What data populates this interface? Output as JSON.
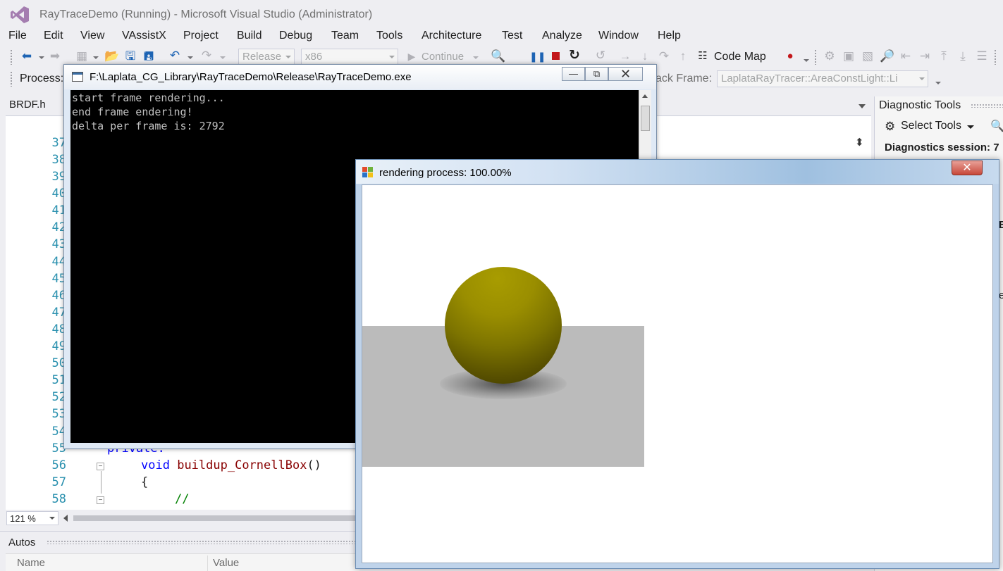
{
  "window": {
    "title": "RayTraceDemo (Running) - Microsoft Visual Studio (Administrator)"
  },
  "menu": [
    "File",
    "Edit",
    "View",
    "VAssistX",
    "Project",
    "Build",
    "Debug",
    "Team",
    "Tools",
    "Architecture",
    "Test",
    "Analyze",
    "Window",
    "Help"
  ],
  "toolbar": {
    "configuration": "Release",
    "platform": "x86",
    "continue_label": "Continue",
    "code_map_label": "Code Map",
    "process_label": "Process:",
    "stack_frame_label": "ack Frame:",
    "stack_frame_value": "LaplataRayTracer::AreaConstLight::Li"
  },
  "editor": {
    "tab_label": "BRDF.h",
    "line_numbers": [
      "37",
      "38",
      "39",
      "40",
      "41",
      "42",
      "43",
      "44",
      "45",
      "46",
      "47",
      "48",
      "49",
      "50",
      "51",
      "52",
      "53",
      "54",
      "55",
      "56",
      "57",
      "58"
    ],
    "code": {
      "line55": "private:",
      "line56_kw": "void",
      "line56_fn": "buildup_CornellBox",
      "line56_tail": "()",
      "line57": "{",
      "line58": "//"
    },
    "zoom": "121 %"
  },
  "autos": {
    "title": "Autos",
    "columns": [
      "Name",
      "Value"
    ]
  },
  "diagnostics": {
    "title": "Diagnostic Tools",
    "select_tools": "Select Tools",
    "session": "Diagnostics session: 7",
    "fragment_b": "B",
    "fragment_e": "e"
  },
  "console": {
    "title": "F:\\Laplata_CG_Library\\RayTraceDemo\\Release\\RayTraceDemo.exe",
    "lines": [
      "start frame rendering...",
      "end frame endering!",
      "delta per frame is: 2792"
    ]
  },
  "render": {
    "title": "rendering process: 100.00%",
    "progress": 1.0
  },
  "colors": {
    "sphere": "#9a8e00",
    "floor": "#bbbbbb",
    "console_bg": "#000000",
    "line_number": "#2b91af",
    "keyword": "#0000ff"
  }
}
